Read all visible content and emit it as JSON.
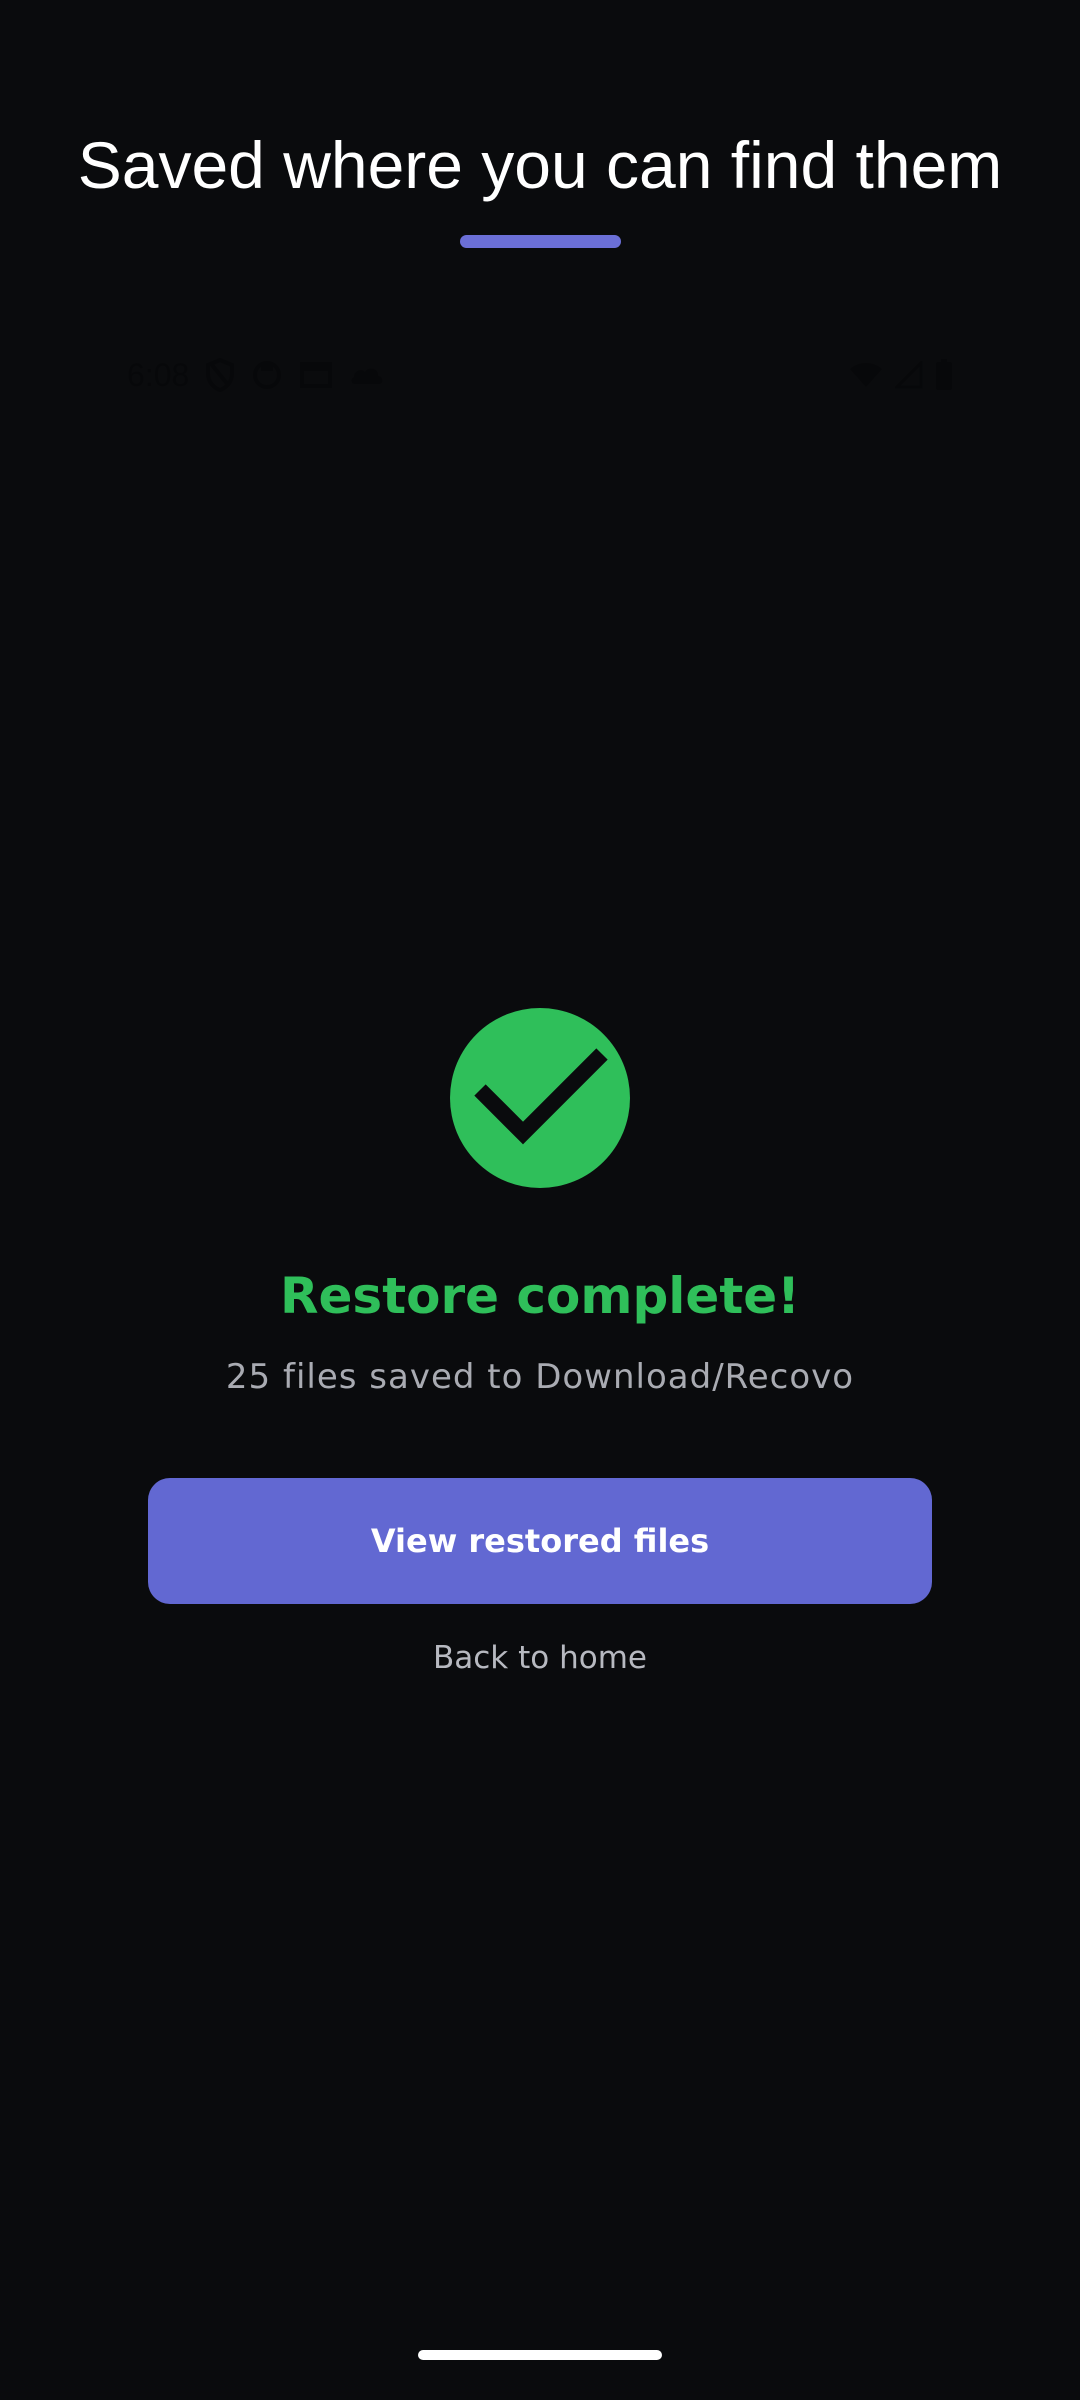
{
  "headline": "Saved where you can find them",
  "status_bar": {
    "time": "6:08",
    "left_icons": [
      "shield-icon",
      "app-icon",
      "window-icon",
      "cloud-icon"
    ],
    "right_icons": [
      "wifi-icon",
      "signal-icon",
      "battery-icon"
    ]
  },
  "result": {
    "icon": "check-circle-icon",
    "title": "Restore complete!",
    "subtitle": "25 files saved to Download/Recovo"
  },
  "actions": {
    "primary_label": "View restored files",
    "secondary_label": "Back to home"
  },
  "colors": {
    "background": "#0a0b0d",
    "accent": "#6268d2",
    "success": "#2fbf5a",
    "text_primary": "#ffffff",
    "text_secondary": "#a9abb2"
  }
}
